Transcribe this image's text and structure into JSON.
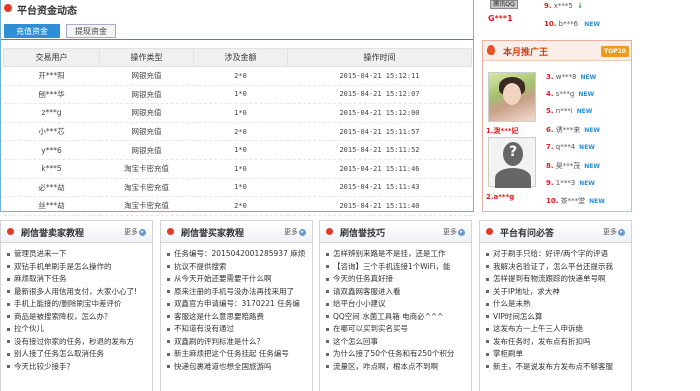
{
  "funds": {
    "title": "平台资金动态",
    "tabs": [
      "充值资金",
      "提现资金"
    ],
    "columns": [
      "交易用户",
      "操作类型",
      "涉及金额",
      "操作时间"
    ],
    "rows": [
      [
        "开***阳",
        "网银充值",
        "2*0",
        "2015-04-21 15:12:11"
      ],
      [
        "刨***华",
        "网银充值",
        "1*0",
        "2015-04-21 15:12:07"
      ],
      [
        "z***g",
        "网银充值",
        "1*0",
        "2015-04-21 15:12:00"
      ],
      [
        "小***芯",
        "网银充值",
        "2*0",
        "2015-04-21 15:11:57"
      ],
      [
        "y***6",
        "网银充值",
        "1*0",
        "2015-04-21 15:11:52"
      ],
      [
        "k***5",
        "淘宝卡密充值",
        "1*0",
        "2015-04-21 15:11:46"
      ],
      [
        "必***劫",
        "淘宝卡密充值",
        "1*0",
        "2015-04-21 15:11:43"
      ],
      [
        "丝***劫",
        "淘宝卡密充值",
        "2*0",
        "2015-04-21 15:11:40"
      ]
    ]
  },
  "right_top": {
    "logo_text": "腾讯QQ",
    "g_user": "G***1",
    "entries": [
      {
        "rank": "9.",
        "name": "x***5",
        "flag": "↓"
      },
      {
        "rank": "10.",
        "name": "b***6",
        "flag": "NEW"
      }
    ]
  },
  "promo": {
    "title": "本月推广王",
    "badge": "TOP10",
    "winners": [
      "1.泼***妃",
      "2.a***g"
    ],
    "entries": [
      {
        "rank": "3.",
        "name": "w***8"
      },
      {
        "rank": "4.",
        "name": "s***g"
      },
      {
        "rank": "5.",
        "name": "n***i"
      },
      {
        "rank": "6.",
        "name": "诱***来"
      },
      {
        "rank": "7.",
        "name": "q***4"
      },
      {
        "rank": "8.",
        "name": "昊***茂"
      },
      {
        "rank": "9.",
        "name": "1***3"
      },
      {
        "rank": "10.",
        "name": "茶***堂"
      }
    ],
    "new_label": "NEW"
  },
  "columns": [
    {
      "title": "刷信誉卖家教程",
      "more": "更多",
      "items": [
        "管理员进来一下",
        "双钻手机单刷手是怎么操作的",
        "麻烦取消下任务",
        "最新很多人用信用支付，大家小心了!",
        "手机上能接的/删除刷宝中差评价",
        "商品是被搜索降权，怎么办？",
        "拉个伙儿",
        "没有接过你家的任务，秒退的发布方",
        "别人接了任务怎么取消任务",
        "今天比较少接手？"
      ]
    },
    {
      "title": "刷信誉买家教程",
      "more": "更多",
      "items": [
        "任务编号：2015042001285937  麻烦",
        "抗议不提供搜索",
        "从今天开始还要需要干什么啊",
        "原来注册的手机号没办法再找来用了",
        "双鑫官方申请编号：3170221  任务编",
        "客服这是什么意思要赔路费",
        "不知道有没有通过",
        "双鑫刷的评判标准是什么？",
        "新主麻烦把这个任务挂起  任务编号",
        "快递包裹难道也想全国旅游吗"
      ]
    },
    {
      "title": "刷信誉技巧",
      "more": "更多",
      "items": [
        "怎样辨别来路是不是挂，还是工作",
        "【咨询】三个手机连接1个WiFi，能",
        "今天的任务真好接",
        "请双鑫网客服进入看",
        "给平台小小建议",
        "QQ空间  水菌工具箱  电商必^^^",
        "在哪可以买到实名买号",
        "这个怎么回事",
        "为什么接了50个任务和有250个积分",
        "流量区，咋点啊，根本点不到啊"
      ]
    },
    {
      "title": "平台有问必答",
      "more": "更多",
      "items": [
        "对于刷手只给：好评/两个字的评语",
        "我解决名验证了，怎么平台还提示我",
        "怎样提到有物流跟踪的快递单号啊",
        "关于IP地址，求大神",
        "什么是未熟",
        "VIP时间怎么算",
        "这发布方一上午三人申诉绝",
        "发布任务时，发布点有折扣吗",
        "掌柜刷单",
        "新主，不是说发布方发布点不够客服"
      ]
    }
  ]
}
